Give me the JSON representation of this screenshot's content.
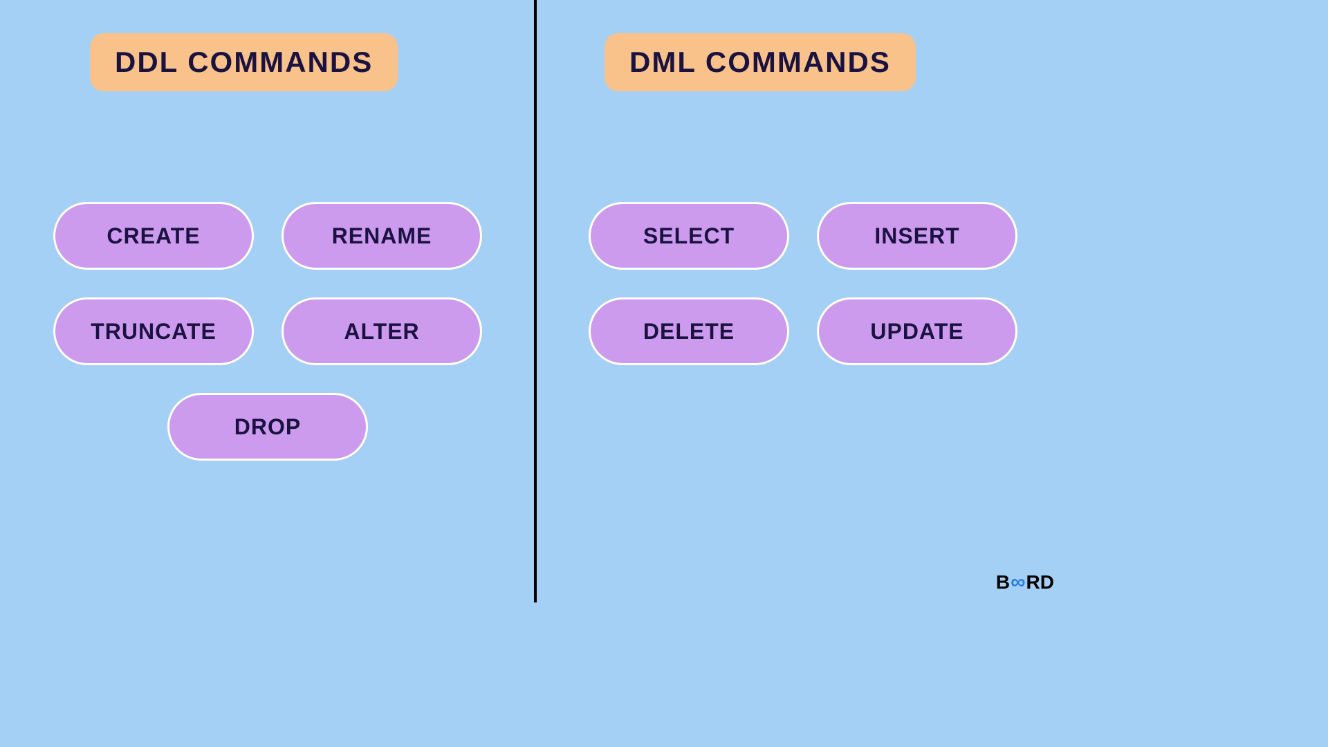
{
  "left": {
    "title": "DDL COMMANDS",
    "commands": [
      "CREATE",
      "RENAME",
      "TRUNCATE",
      "ALTER",
      "DROP"
    ]
  },
  "right": {
    "title": "DML COMMANDS",
    "commands": [
      "SELECT",
      "INSERT",
      "DELETE",
      "UPDATE"
    ]
  },
  "logo": {
    "part1": "B",
    "part2": "∞",
    "part3": "RD"
  }
}
